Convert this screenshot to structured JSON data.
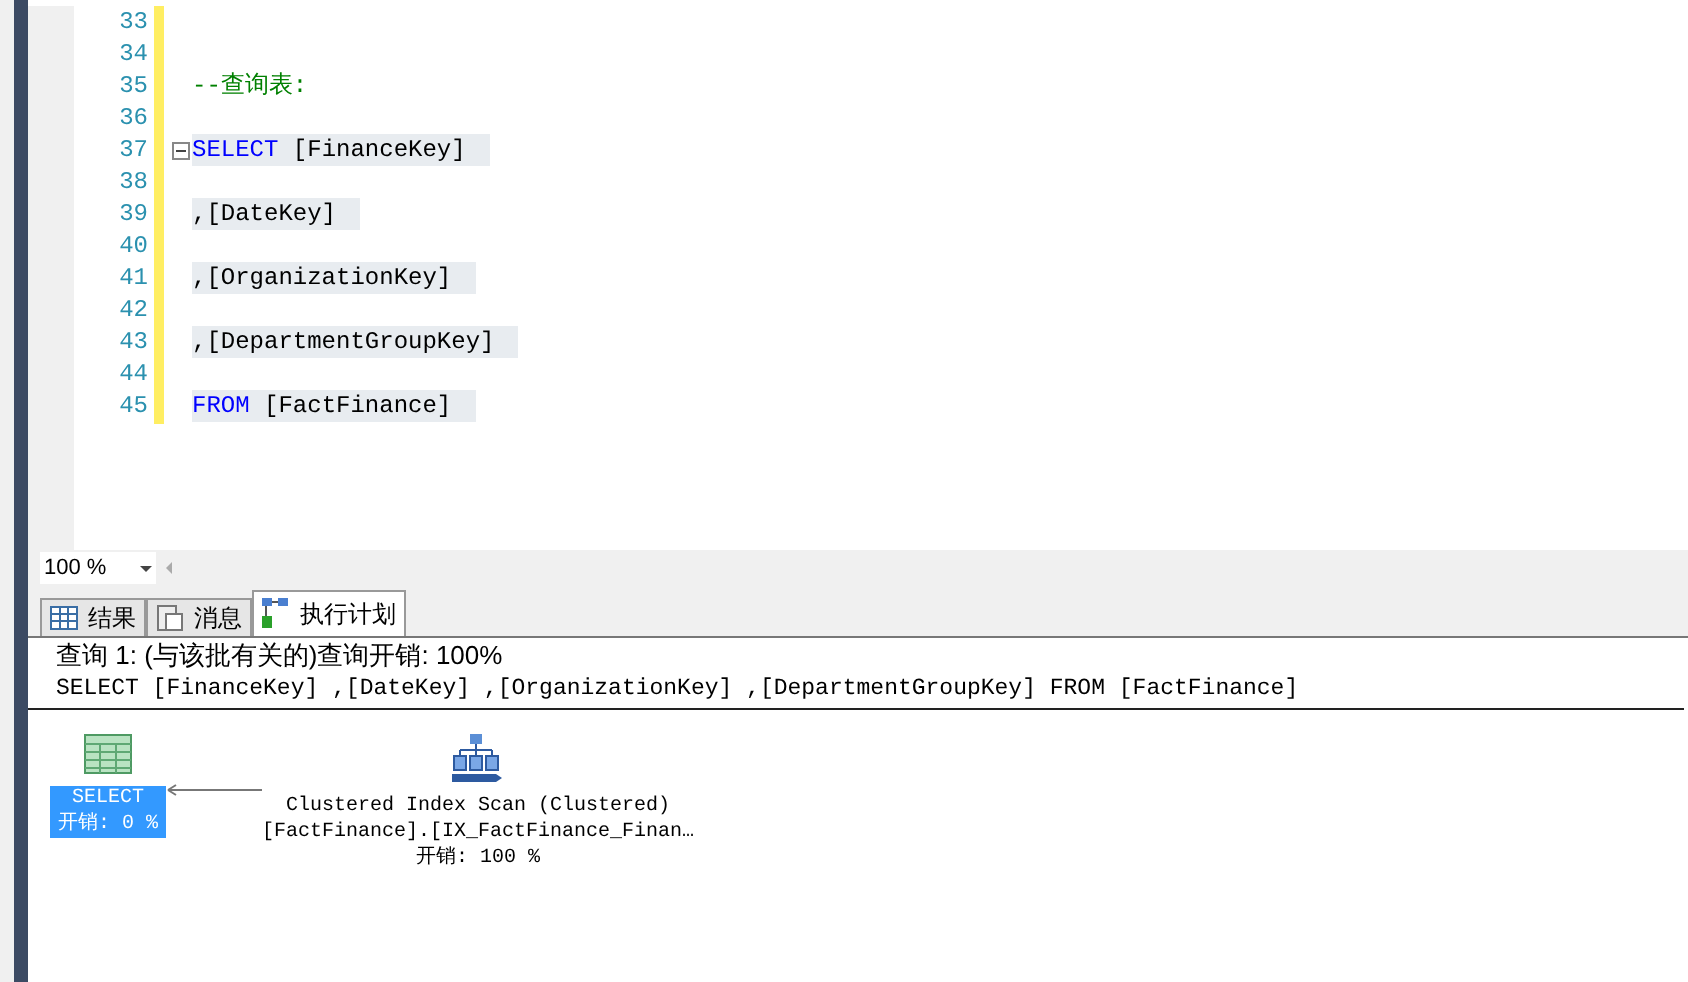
{
  "editor": {
    "lines": [
      {
        "number": "33",
        "fold": false
      },
      {
        "number": "34",
        "fold": false
      },
      {
        "number": "35",
        "fold": false,
        "tokens": [
          {
            "kind": "comment",
            "text": "--查询表:"
          }
        ]
      },
      {
        "number": "36",
        "fold": false
      },
      {
        "number": "37",
        "fold": true,
        "tokens": [
          {
            "kind": "keyword",
            "text": "SELECT"
          },
          {
            "kind": "plain",
            "text": " [FinanceKey]"
          }
        ]
      },
      {
        "number": "38",
        "fold": false
      },
      {
        "number": "39",
        "fold": false,
        "tokens": [
          {
            "kind": "plain",
            "text": ",[DateKey]"
          }
        ]
      },
      {
        "number": "40",
        "fold": false
      },
      {
        "number": "41",
        "fold": false,
        "tokens": [
          {
            "kind": "plain",
            "text": ",[OrganizationKey]"
          }
        ]
      },
      {
        "number": "42",
        "fold": false
      },
      {
        "number": "43",
        "fold": false,
        "tokens": [
          {
            "kind": "plain",
            "text": ",[DepartmentGroupKey]"
          }
        ]
      },
      {
        "number": "44",
        "fold": false
      },
      {
        "number": "45",
        "fold": false,
        "tokens": [
          {
            "kind": "keyword",
            "text": "FROM"
          },
          {
            "kind": "plain",
            "text": " [FactFinance]"
          }
        ]
      }
    ]
  },
  "zoom": "100 %",
  "tabs": [
    {
      "label": "结果",
      "kind": "grid",
      "selected": false
    },
    {
      "label": "消息",
      "kind": "messages",
      "selected": false
    },
    {
      "label": "执行计划",
      "kind": "plan",
      "selected": true
    }
  ],
  "plan": {
    "header": "查询 1: (与该批有关的)查询开销: 100%",
    "sql": "SELECT [FinanceKey] ,[DateKey] ,[OrganizationKey] ,[DepartmentGroupKey] FROM [FactFinance]",
    "nodes": [
      {
        "kind": "select",
        "selected": true,
        "lines": [
          "SELECT",
          "开销: 0 %"
        ]
      },
      {
        "kind": "scan",
        "selected": false,
        "lines": [
          "Clustered Index Scan (Clustered)",
          "[FactFinance].[IX_FactFinance_Finan…",
          "开销: 100 %"
        ]
      }
    ]
  }
}
